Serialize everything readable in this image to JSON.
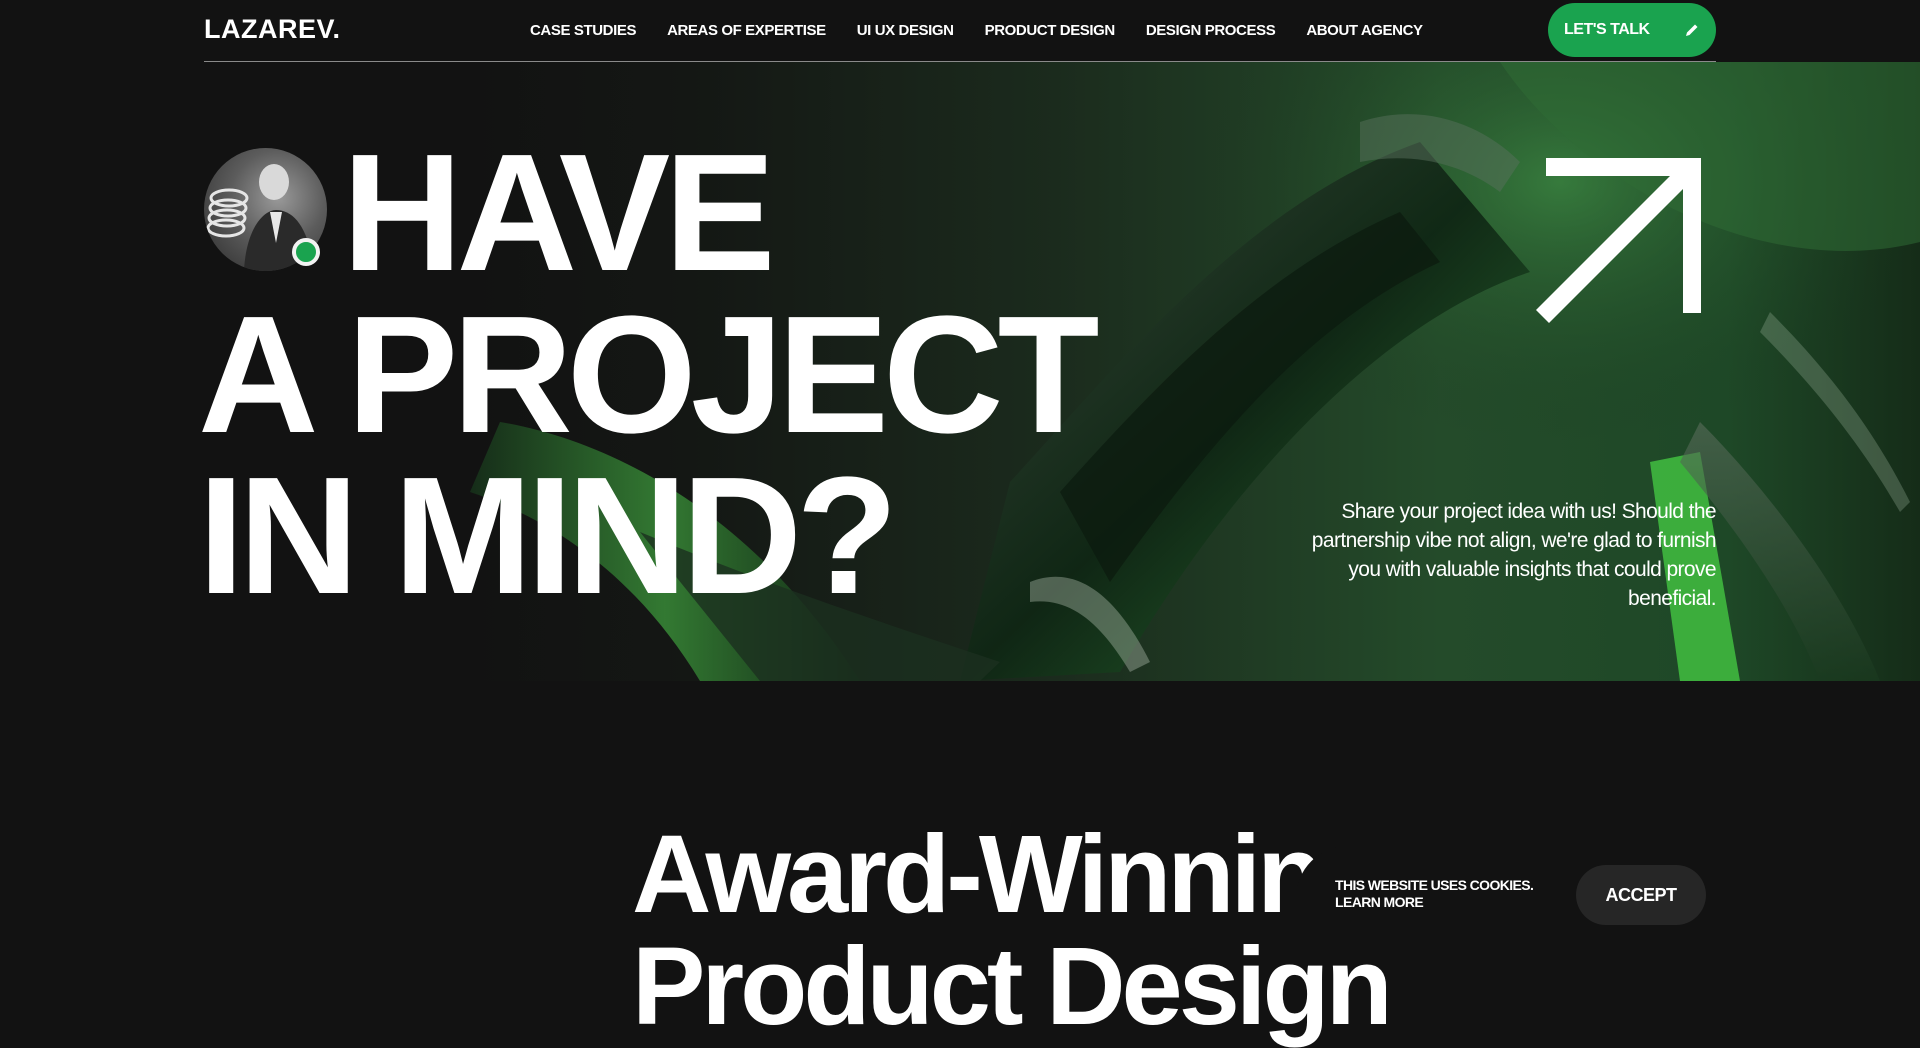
{
  "header": {
    "logo": "LAZAREV.",
    "nav": [
      "CASE STUDIES",
      "AREAS OF EXPERTISE",
      "UI UX DESIGN",
      "PRODUCT DESIGN",
      "DESIGN PROCESS",
      "ABOUT AGENCY"
    ],
    "cta_label": "LET'S TALK",
    "cta_icon": "pencil-icon"
  },
  "hero": {
    "line1": "HAVE",
    "line2": "A PROJECT",
    "line3": "IN MIND?",
    "description": "Share your project idea with us! Should the partnership vibe not align, we're glad to furnish you with valuable insights that could prove beneficial.",
    "arrow_icon": "arrow-up-right-icon",
    "status": "online"
  },
  "awards": {
    "title_line1": "Award-Winning",
    "title_line2": "Product Design"
  },
  "cookie": {
    "text": "THIS WEBSITE USES COOKIES.",
    "link": "LEARN MORE",
    "accept_label": "ACCEPT"
  },
  "colors": {
    "background": "#121212",
    "accent": "#1aa34f",
    "text": "#ffffff"
  }
}
